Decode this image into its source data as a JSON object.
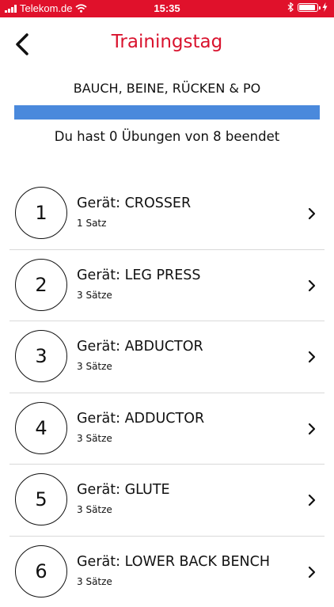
{
  "status_bar": {
    "carrier": "Telekom.de",
    "time": "15:35"
  },
  "header": {
    "title": "Trainingstag",
    "back_icon": "chevron-left-icon",
    "accent_color": "#d9132e"
  },
  "workout": {
    "title": "BAUCH, BEINE, RÜCKEN & PO",
    "progress_fraction": 0,
    "progress_text": "Du hast 0 Übungen von 8 beendet",
    "progress_color": "#4a89dc"
  },
  "exercises": [
    {
      "number": "1",
      "title": "Gerät: CROSSER",
      "sets": "1 Satz"
    },
    {
      "number": "2",
      "title": "Gerät: LEG PRESS",
      "sets": "3 Sätze"
    },
    {
      "number": "3",
      "title": "Gerät: ABDUCTOR",
      "sets": "3 Sätze"
    },
    {
      "number": "4",
      "title": "Gerät: ADDUCTOR",
      "sets": "3 Sätze"
    },
    {
      "number": "5",
      "title": "Gerät: GLUTE",
      "sets": "3 Sätze"
    },
    {
      "number": "6",
      "title": "Gerät: LOWER BACK BENCH",
      "sets": "3 Sätze"
    }
  ]
}
